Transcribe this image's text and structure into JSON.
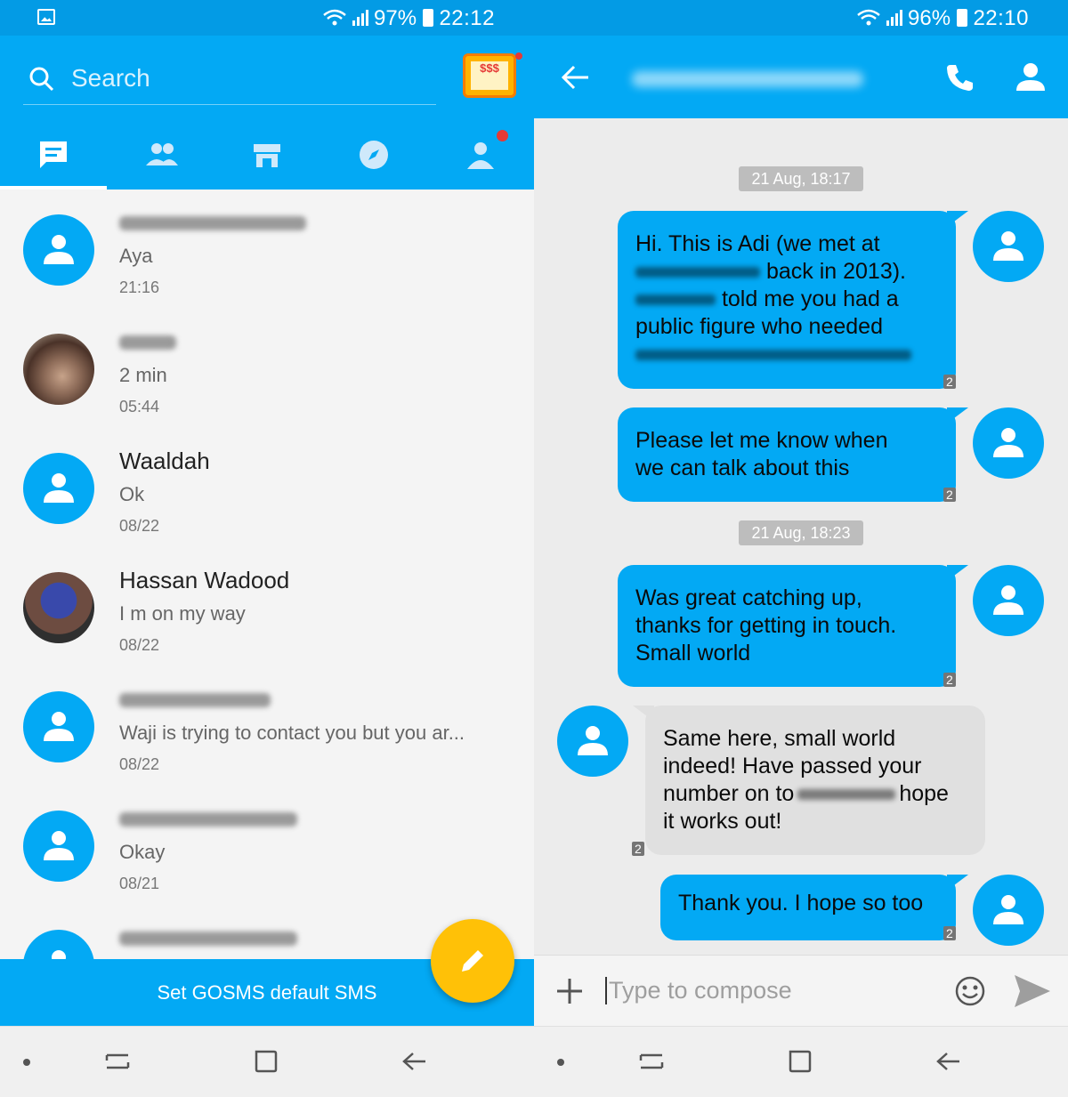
{
  "left": {
    "status": {
      "battery": "97%",
      "time": "22:12"
    },
    "search_placeholder": "Search",
    "slot_label": "$$$",
    "conversations": [
      {
        "name": "",
        "message": "Aya",
        "time": "21:16"
      },
      {
        "name": "",
        "message": "2 min",
        "time": "05:44"
      },
      {
        "name": "Waaldah",
        "message": "Ok",
        "time": "08/22"
      },
      {
        "name": "Hassan Wadood",
        "message": "I m on my way",
        "time": "08/22"
      },
      {
        "name": "",
        "message": "Waji is trying to contact you but you ar...",
        "time": "08/22"
      },
      {
        "name": "",
        "message": "Okay",
        "time": "08/21"
      }
    ],
    "default_sms_label": "Set GOSMS default SMS"
  },
  "right": {
    "status": {
      "battery": "96%",
      "time": "22:10"
    },
    "date_chips": [
      "21 Aug, 18:17",
      "21 Aug, 18:23"
    ],
    "messages": [
      {
        "dir": "out",
        "lines": [
          "Hi. This is Adi (we met at",
          "back in 2013).",
          "told me you had a",
          "public figure who needed"
        ]
      },
      {
        "dir": "out",
        "lines": [
          "Please let me know when",
          "we can talk about this"
        ]
      },
      {
        "dir": "out",
        "lines": [
          "Was great catching up,",
          "thanks for getting in touch.",
          "Small world"
        ]
      },
      {
        "dir": "in",
        "lines": [
          "Same here, small world",
          "indeed! Have passed your",
          "number on to",
          "hope",
          "it works out!"
        ]
      },
      {
        "dir": "out",
        "lines": [
          "Thank you. I hope so too"
        ]
      }
    ],
    "sim_badge": "2",
    "compose_placeholder": "Type to compose"
  },
  "colors": {
    "primary": "#03a9f4",
    "accent_fab": "#ffc107",
    "incoming": "#e0e0e0"
  },
  "icons": [
    "image-icon",
    "wifi-icon",
    "signal-icon",
    "battery-icon",
    "search-icon",
    "slot-machine-icon",
    "chat-icon",
    "contacts-icon",
    "store-icon",
    "compass-icon",
    "profile-icon",
    "pencil-icon",
    "back-arrow-icon",
    "phone-icon",
    "contact-icon",
    "plus-icon",
    "emoji-icon",
    "send-icon",
    "recent-apps-icon",
    "home-icon",
    "nav-back-icon"
  ]
}
